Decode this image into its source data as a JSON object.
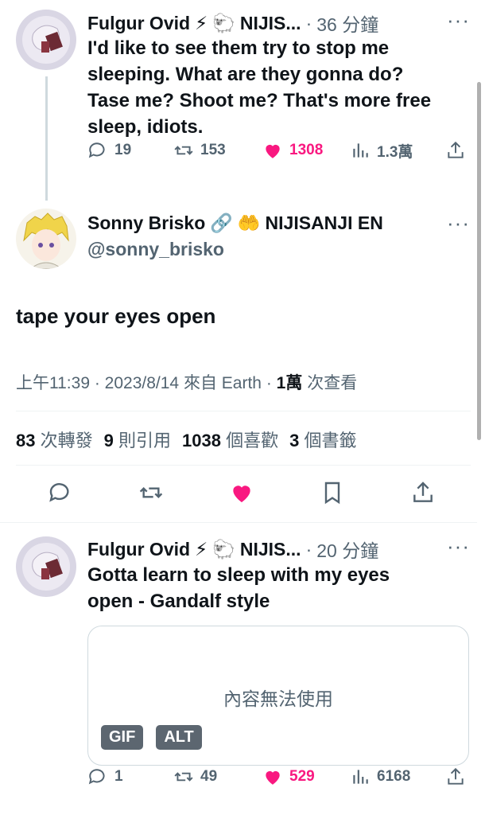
{
  "tweets": [
    {
      "author": "Fulgur Ovid",
      "author_suffix": "NIJIS...",
      "time": "36 分鐘",
      "text": "I'd like to see them try to stop me sleeping. What are they gonna do? Tase me? Shoot me? That's more free sleep, idiots.",
      "replies": "19",
      "retweets": "153",
      "likes": "1308",
      "views": "1.3萬"
    },
    {
      "author": "Fulgur Ovid",
      "author_suffix": "NIJIS...",
      "time": "20 分鐘",
      "text": "Gotta learn to sleep with my eyes open - Gandalf style",
      "media_unavailable": "內容無法使用",
      "media_badges": [
        "GIF",
        "ALT"
      ],
      "replies": "1",
      "retweets": "49",
      "likes": "529",
      "views": "6168"
    }
  ],
  "main_tweet": {
    "author": "Sonny Brisko",
    "author_suffix": "NIJISANJI EN",
    "handle": "@sonny_brisko",
    "text": "tape your eyes open",
    "time": "上午11:39",
    "date": "2023/8/14",
    "source_prefix": "來自",
    "source": "Earth",
    "views_num": "1萬",
    "views_label": "次查看",
    "stats": [
      {
        "num": "83",
        "label": "次轉發"
      },
      {
        "num": "9",
        "label": "則引用"
      },
      {
        "num": "1038",
        "label": "個喜歡"
      },
      {
        "num": "3",
        "label": "個書籤"
      }
    ]
  },
  "colors": {
    "like": "#f91880",
    "muted": "#536471",
    "text": "#0f1419"
  }
}
